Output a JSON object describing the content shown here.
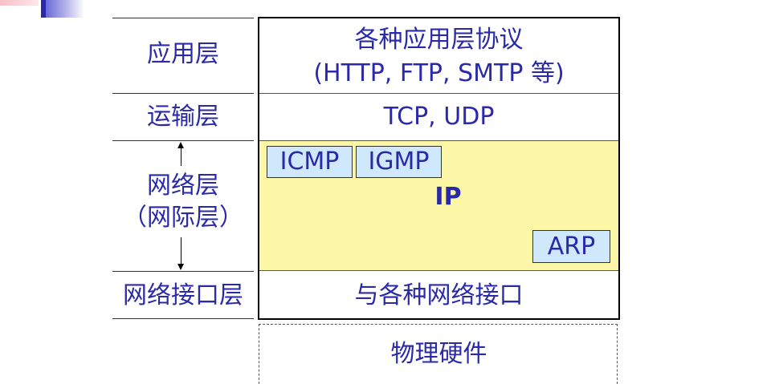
{
  "left_layers": {
    "application": "应用层",
    "transport": "运输层",
    "network": "网络层",
    "network_alt": "（网际层）",
    "interface": "网络接口层"
  },
  "stack": {
    "application_line1": "各种应用层协议",
    "application_line2": "(HTTP, FTP, SMTP 等)",
    "transport": "TCP, UDP",
    "ip": "IP",
    "icmp": "ICMP",
    "igmp": "IGMP",
    "arp": "ARP",
    "interface": "与各种网络接口",
    "hardware": "物理硬件"
  },
  "colors": {
    "text": "#2a2aa8",
    "ip_background": "#fbf7a6",
    "protocol_box": "#cfe8fb"
  }
}
